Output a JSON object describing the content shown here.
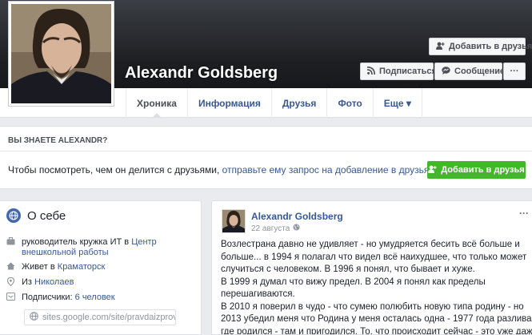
{
  "profile": {
    "name": "Alexandr Goldsberg"
  },
  "actions": {
    "add_friend": "Добавить в друзья",
    "subscribe": "Подписаться",
    "message": "Сообщение",
    "more": "···"
  },
  "tabs": [
    {
      "label": "Хроника"
    },
    {
      "label": "Информация"
    },
    {
      "label": "Друзья"
    },
    {
      "label": "Фото"
    },
    {
      "label": "Еще ▾"
    }
  ],
  "know": {
    "heading": "ВЫ ЗНАЕТЕ ALEXANDR?",
    "text_prefix": "Чтобы посмотреть, чем он делится с друзьями,",
    "link": "отправьте ему запрос на добавление в друзья",
    "text_suffix": ".",
    "button": "Добавить в друзья"
  },
  "about": {
    "title": "О себе",
    "job_prefix": "руководитель кружка ИТ в",
    "job_link": "Центр",
    "job_link2": "внешкольной работы",
    "lives_prefix": "Живет в",
    "lives_city": "Краматорск",
    "from_prefix": "Из",
    "from_city": "Николаев",
    "followers_prefix": "Подписчики:",
    "followers_count": "6 человек",
    "website": "sites.google.com/site/pravdaizprovincii"
  },
  "post": {
    "author": "Alexandr Goldsberg",
    "date": "22 августа",
    "more": "···",
    "lines": [
      "Возлестрана давно не удивляет - но умудряется бесить всё больше и",
      "больше... в 1994 я полагал что видел всё наихудшее, что только может",
      "случиться с человеком. В 1996 я понял, что бывает и хуже.",
      "В 1999 я думал что вижу предел. В 2004 я понял как пределы",
      "перешагиваются.",
      "В 2010 я поверил в чудо - что сумею полюбить новую типа родину - но",
      "2013 убедил меня что Родина у меня осталась одна - 1977 года разлива,",
      "где родился - там и пригодился. То, что происходит сейчас - это уже даже"
    ]
  },
  "icons": {
    "add_friend": "add-friend-icon",
    "rss": "rss-icon",
    "message": "message-icon",
    "globe": "globe-icon",
    "briefcase": "briefcase-icon",
    "home": "home-icon",
    "location": "location-pin-icon",
    "followers": "followers-icon",
    "link": "link-icon",
    "public": "public-globe-icon"
  },
  "colors": {
    "link": "#365899",
    "green": "#42b72a",
    "fb_blue": "#4267b2"
  }
}
